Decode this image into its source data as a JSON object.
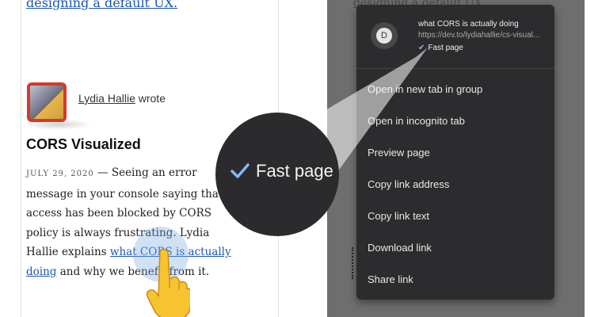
{
  "article": {
    "top_link": "designing a default UX.",
    "author_name": "Lydia Hallie",
    "author_suffix": " wrote",
    "title": "CORS Visualized",
    "date": "JULY 29, 2020",
    "body_1": " — Seeing an error message in your console saying that access has been blocked by CORS policy is always frustrating. Lydia Hallie explains ",
    "link_text": "what CORS is actually doing",
    "body_2": " and why we benefit from it."
  },
  "context_menu": {
    "favicon_letter": "D",
    "link_title": "what CORS is actually doing",
    "link_url": "https://dev.to/lydiahallie/cs-visual...",
    "badge": "Fast page",
    "items": [
      "Open in new tab in group",
      "Open in incognito tab",
      "Preview page",
      "Copy link address",
      "Copy link text",
      "Download link",
      "Share link"
    ]
  },
  "callout": {
    "label": "Fast page"
  },
  "colors": {
    "link": "#1a56b5",
    "menu_bg": "#2c2c2e",
    "check": "#8ab4f8"
  },
  "icons": [
    "check-icon",
    "pointing-hand-icon"
  ]
}
